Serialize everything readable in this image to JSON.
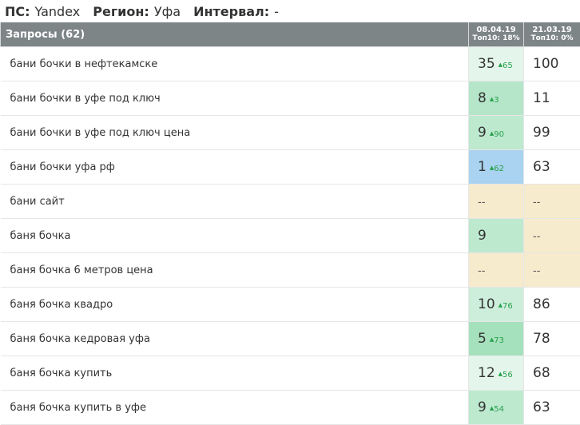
{
  "filters": {
    "ps_label": "ПС:",
    "ps_value": "Yandex",
    "region_label": "Регион:",
    "region_value": "Уфа",
    "interval_label": "Интервал:",
    "interval_value": "-"
  },
  "table": {
    "query_header": "Запросы (62)",
    "dates": [
      {
        "date": "08.04.19",
        "top": "Топ10: 18%"
      },
      {
        "date": "21.03.19",
        "top": "Топ10: 0%"
      }
    ],
    "rows": [
      {
        "query": "бани бочки в нефтекамске",
        "pos1": "35",
        "delta": "65",
        "pos2": "100",
        "bg1": "#e4f6ec",
        "bg2": "#ffffff"
      },
      {
        "query": "бани бочки в уфе под ключ",
        "pos1": "8",
        "delta": "3",
        "pos2": "11",
        "bg1": "#b5e6c9",
        "bg2": "#ffffff"
      },
      {
        "query": "бани бочки в уфе под ключ цена",
        "pos1": "9",
        "delta": "90",
        "pos2": "99",
        "bg1": "#bde9cf",
        "bg2": "#ffffff"
      },
      {
        "query": "бани бочки уфа рф",
        "pos1": "1",
        "delta": "62",
        "pos2": "63",
        "bg1": "#a9d3f0",
        "bg2": "#ffffff"
      },
      {
        "query": "бани сайт",
        "pos1": "--",
        "delta": "",
        "pos2": "--",
        "bg1": "#f7ebcd",
        "bg2": "#f7ebcd"
      },
      {
        "query": "баня бочка",
        "pos1": "9",
        "delta": "",
        "pos2": "--",
        "bg1": "#bde9cf",
        "bg2": "#f7ebcd"
      },
      {
        "query": "баня бочка 6 метров цена",
        "pos1": "--",
        "delta": "",
        "pos2": "--",
        "bg1": "#f7ebcd",
        "bg2": "#f7ebcd"
      },
      {
        "query": "баня бочка квадро",
        "pos1": "10",
        "delta": "76",
        "pos2": "86",
        "bg1": "#cdeedb",
        "bg2": "#ffffff"
      },
      {
        "query": "баня бочка кедровая уфа",
        "pos1": "5",
        "delta": "73",
        "pos2": "78",
        "bg1": "#a6e1bd",
        "bg2": "#ffffff"
      },
      {
        "query": "баня бочка купить",
        "pos1": "12",
        "delta": "56",
        "pos2": "68",
        "bg1": "#e4f6ec",
        "bg2": "#ffffff"
      },
      {
        "query": "баня бочка купить в уфе",
        "pos1": "9",
        "delta": "54",
        "pos2": "63",
        "bg1": "#bde9cf",
        "bg2": "#ffffff"
      }
    ]
  }
}
